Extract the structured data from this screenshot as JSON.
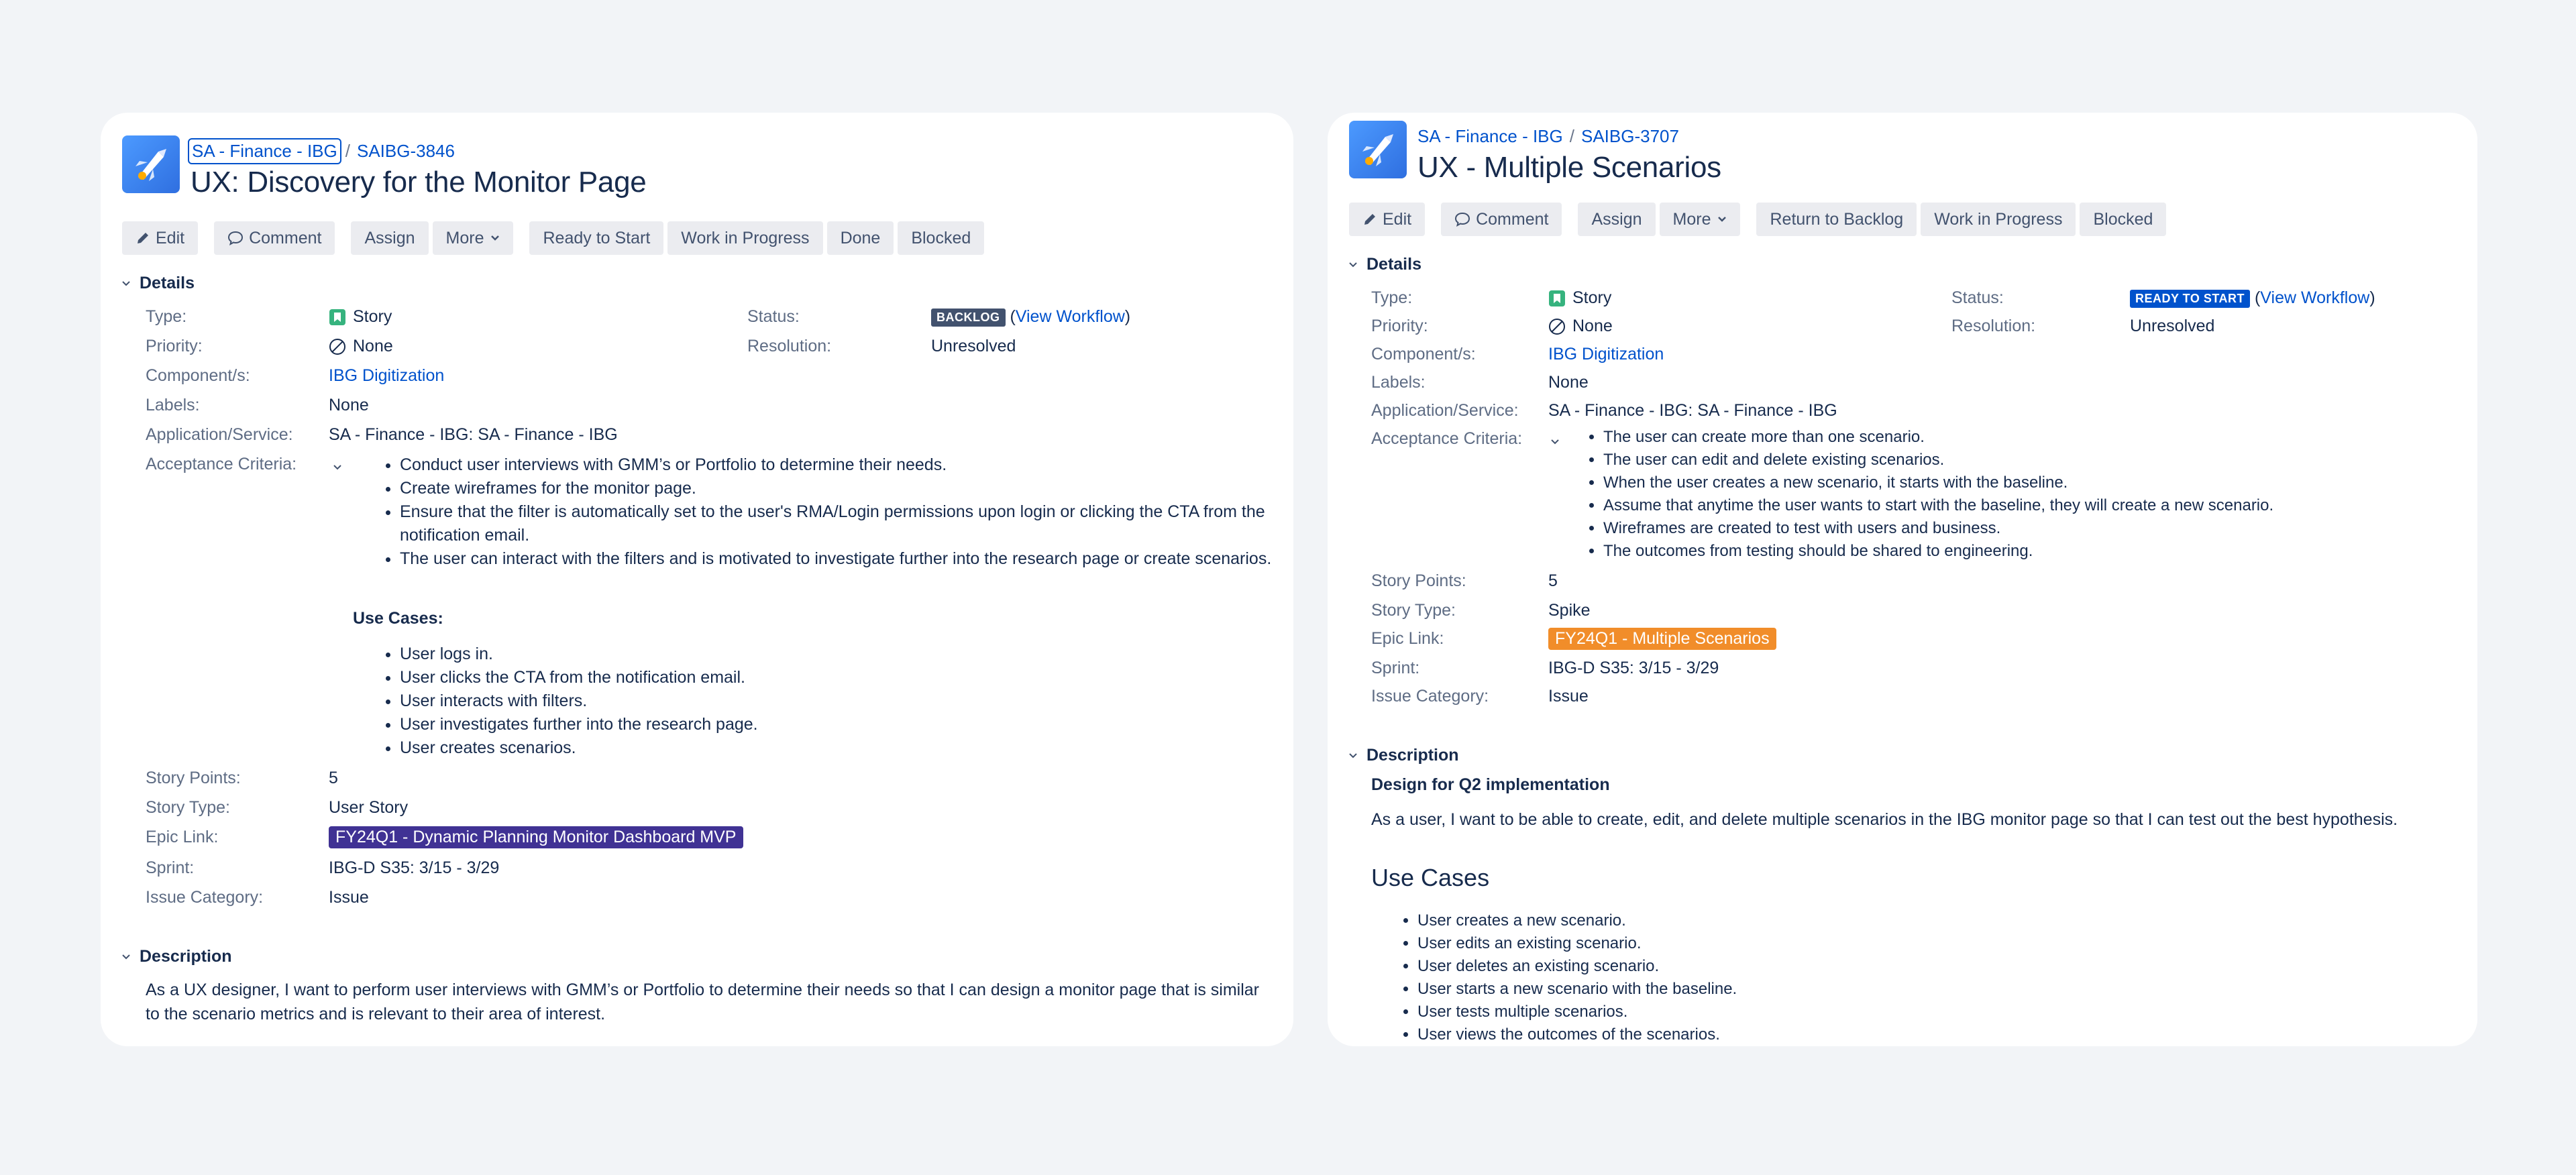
{
  "colors": {
    "page_bg": "#f2f4f7",
    "link": "#0052cc",
    "backlog_lozenge": "#42526e",
    "ready_lozenge": "#0052cc",
    "epic_purple": "#403294",
    "epic_orange": "#f18d2a"
  },
  "left": {
    "breadcrumb": {
      "project": "SA - Finance - IBG",
      "separator": "/",
      "issue_key": "SAIBG-3846"
    },
    "title": "UX: Discovery for the Monitor Page",
    "toolbar": {
      "edit": "Edit",
      "comment": "Comment",
      "assign": "Assign",
      "more": "More",
      "t1": "Ready to Start",
      "t2": "Work in Progress",
      "t3": "Done",
      "t4": "Blocked"
    },
    "details": {
      "heading": "Details",
      "type_label": "Type:",
      "type_value": "Story",
      "status_label": "Status:",
      "status_value": "BACKLOG",
      "view_workflow": "View Workflow",
      "priority_label": "Priority:",
      "priority_value": "None",
      "resolution_label": "Resolution:",
      "resolution_value": "Unresolved",
      "components_label": "Component/s:",
      "components_value": "IBG Digitization",
      "labels_label": "Labels:",
      "labels_value": "None",
      "app_label": "Application/Service:",
      "app_value": "SA - Finance - IBG: SA - Finance - IBG",
      "ac_label": "Acceptance Criteria:",
      "ac_items": [
        "Conduct user interviews with GMM’s or Portfolio to determine their needs.",
        "Create wireframes for the monitor page.",
        "Ensure that the filter is automatically set to the user's RMA/Login permissions upon login or clicking the CTA from the notification email.",
        "The user can interact with the filters and is motivated to investigate further into the research page or create scenarios."
      ],
      "use_cases_title": "Use Cases:",
      "use_cases": [
        "User logs in.",
        "User clicks the CTA from the notification email.",
        "User interacts with filters.",
        "User investigates further into the research page.",
        "User creates scenarios."
      ],
      "sp_label": "Story Points:",
      "sp_value": "5",
      "st_label": "Story Type:",
      "st_value": "User Story",
      "epic_label": "Epic Link:",
      "epic_value": "FY24Q1 - Dynamic Planning Monitor Dashboard MVP",
      "sprint_label": "Sprint:",
      "sprint_value": "IBG-D S35: 3/15 - 3/29",
      "ic_label": "Issue Category:",
      "ic_value": "Issue"
    },
    "description": {
      "heading": "Description",
      "text": "As a UX designer, I want to perform user interviews with GMM’s or Portfolio to determine their needs so that I can design a monitor page that is similar to the scenario metrics and is relevant to their area of interest."
    }
  },
  "right": {
    "breadcrumb": {
      "project": "SA - Finance - IBG",
      "separator": "/",
      "issue_key": "SAIBG-3707"
    },
    "title": "UX - Multiple Scenarios",
    "toolbar": {
      "edit": "Edit",
      "comment": "Comment",
      "assign": "Assign",
      "more": "More",
      "t1": "Return to Backlog",
      "t2": "Work in Progress",
      "t3": "Blocked"
    },
    "details": {
      "heading": "Details",
      "type_label": "Type:",
      "type_value": "Story",
      "status_label": "Status:",
      "status_value": "READY TO START",
      "view_workflow": "View Workflow",
      "priority_label": "Priority:",
      "priority_value": "None",
      "resolution_label": "Resolution:",
      "resolution_value": "Unresolved",
      "components_label": "Component/s:",
      "components_value": "IBG Digitization",
      "labels_label": "Labels:",
      "labels_value": "None",
      "app_label": "Application/Service:",
      "app_value": "SA - Finance - IBG: SA - Finance - IBG",
      "ac_label": "Acceptance Criteria:",
      "ac_items": [
        "The user can create more than one scenario.",
        "The user can edit and delete existing scenarios.",
        "When the user creates a new scenario, it starts with the baseline.",
        "Assume that anytime the user wants to start with the baseline, they will create a new scenario.",
        "Wireframes are created to test with users and business.",
        "The outcomes from testing should be shared to engineering."
      ],
      "sp_label": "Story Points:",
      "sp_value": "5",
      "st_label": "Story Type:",
      "st_value": "Spike",
      "epic_label": "Epic Link:",
      "epic_value": "FY24Q1 - Multiple Scenarios",
      "sprint_label": "Sprint:",
      "sprint_value": "IBG-D S35: 3/15 - 3/29",
      "ic_label": "Issue Category:",
      "ic_value": "Issue"
    },
    "description": {
      "heading": "Description",
      "subheading": "Design for Q2 implementation",
      "text": "As a user, I want to be able to create, edit, and delete multiple scenarios in the IBG monitor page so that I can test out the best hypothesis.",
      "use_cases_heading": "Use Cases",
      "use_cases": [
        "User creates a new scenario.",
        "User edits an existing scenario.",
        "User deletes an existing scenario.",
        "User starts a new scenario with the baseline.",
        "User tests multiple scenarios.",
        "User views the outcomes of the scenarios."
      ]
    }
  }
}
